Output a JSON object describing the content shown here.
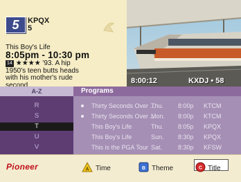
{
  "channel": {
    "number": "5",
    "call_sign": "KPQX",
    "sub_number": "5"
  },
  "now_showing": {
    "title": "This Boy's Life",
    "time_range": "8:05pm - 10:30 pm",
    "rating": "14",
    "stars": "★★★★",
    "description": " '93. A hip 1950's teen butts heads with his mother's rude second..."
  },
  "video": {
    "clock": "8:00:12",
    "channel": "KXDJ • 58"
  },
  "header": {
    "left": "A-Z",
    "right": "Programs"
  },
  "letters": [
    "R",
    "S",
    "T",
    "U",
    "V"
  ],
  "selected_letter_index": 2,
  "programs": [
    {
      "title": "Thirty Seconds Over ...",
      "day": "Thu.",
      "time": "8:00p",
      "channel": "KTCM",
      "marked": true
    },
    {
      "title": "Thirty Seconds Over ...",
      "day": "Mon.",
      "time": "8:00p",
      "channel": "KTCM",
      "marked": true
    },
    {
      "title": "This Boy's Life",
      "day": "Thu.",
      "time": "8:05p",
      "channel": "KPQX",
      "marked": false
    },
    {
      "title": "This Boy's Life",
      "day": "Sun.",
      "time": "8:30p",
      "channel": "KPQX",
      "marked": false
    },
    {
      "title": "This is the PGA Tour",
      "day": "Sat.",
      "time": "8:30p",
      "channel": "KFSW",
      "marked": false
    }
  ],
  "footer": {
    "brand": "Pioneer",
    "time_label": "Time",
    "theme_label": "Theme",
    "title_label": "Title",
    "time_key": "A",
    "theme_key": "B",
    "title_key": "C"
  },
  "colors": {
    "accent_purple": "#8d6a9e",
    "list_bg": "#a58fb5",
    "letters_bg": "#5e3d73",
    "brand_red": "#c0121b",
    "panel_cream": "#f6edc6"
  }
}
